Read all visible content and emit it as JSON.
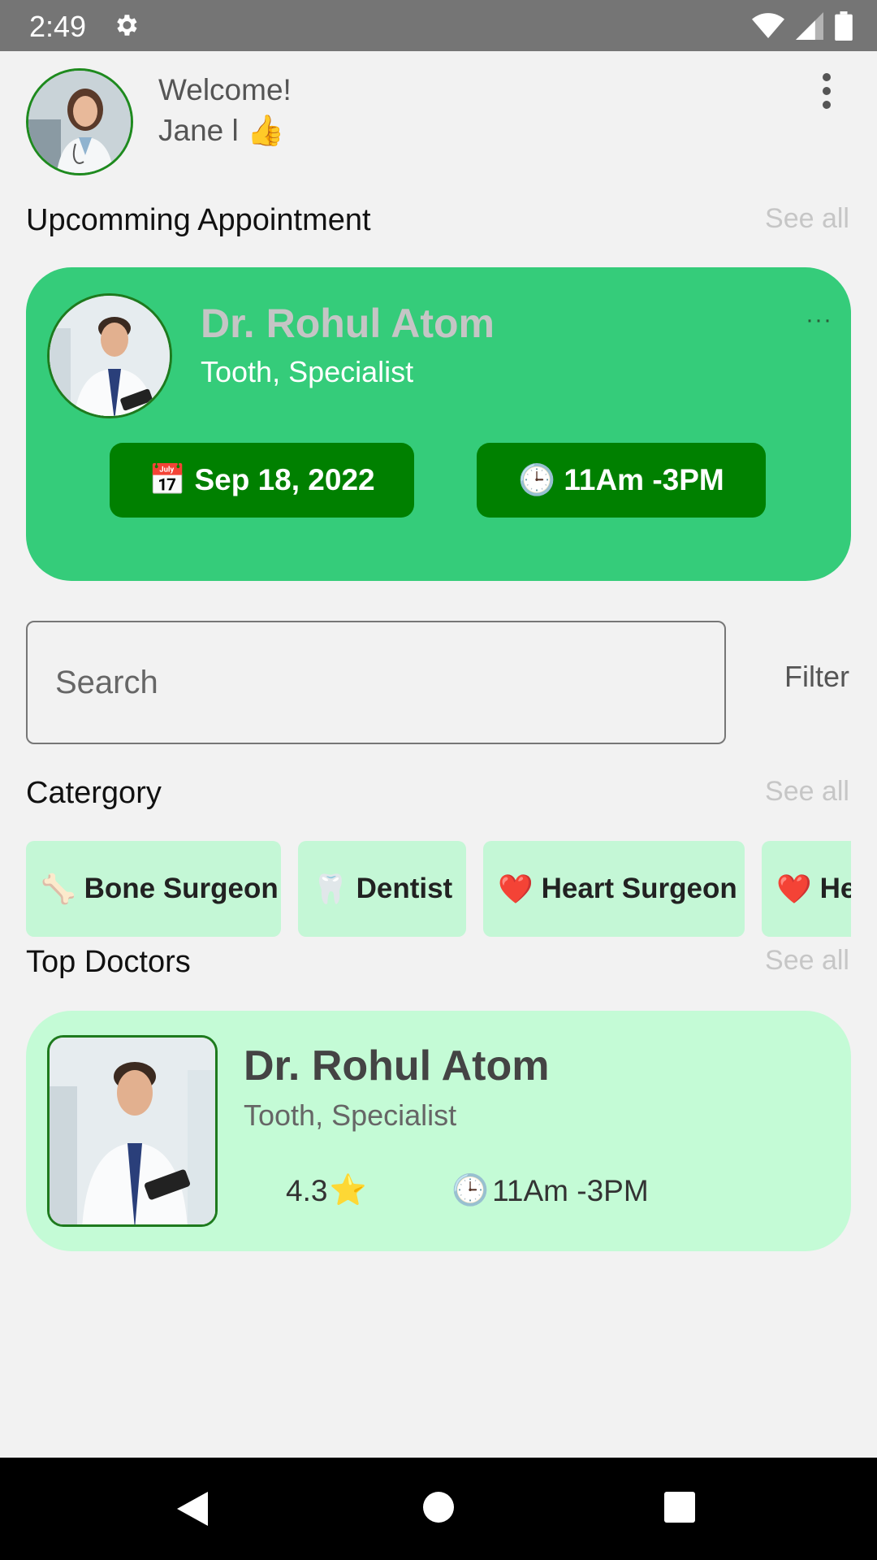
{
  "status_bar": {
    "time": "2:49",
    "icons": [
      "gear-icon",
      "wifi-icon",
      "signal-icon",
      "battery-icon"
    ]
  },
  "header": {
    "welcome": "Welcome!",
    "user_name": "Jane l",
    "emoji": "👍",
    "menu_icon": "more-vert-icon"
  },
  "appointment_section": {
    "title": "Upcomming Appointment",
    "see_all": "See all",
    "card": {
      "doctor_name": "Dr. Rohul Atom",
      "specialty": "Tooth, Specialist",
      "more": "···",
      "date_icon": "📅",
      "date": "Sep 18, 2022",
      "time_icon": "🕒",
      "time": "11Am -3PM"
    }
  },
  "search": {
    "placeholder": "Search",
    "filter_label": "Filter"
  },
  "category_section": {
    "title": "Catergory",
    "see_all": "See all",
    "items": [
      {
        "icon": "🦴",
        "label": "Bone Surgeon"
      },
      {
        "icon": "🦷",
        "label": "Dentist"
      },
      {
        "icon": "❤️",
        "label": "Heart Surgeon"
      },
      {
        "icon": "❤️",
        "label": "Heart Surgeon"
      }
    ]
  },
  "top_doctors_section": {
    "title": "Top Doctors",
    "see_all": "See all",
    "doctors": [
      {
        "name": "Dr. Rohul Atom",
        "specialty": "Tooth, Specialist",
        "rating": "4.3",
        "star": "⭐",
        "clock": "🕒",
        "hours": "11Am -3PM"
      }
    ]
  },
  "colors": {
    "appointment_card": "#35cc7a",
    "pill": "#008000",
    "chip": "#c4f7d6",
    "doctor_card": "#c4fbd6",
    "status_bar": "#757575"
  }
}
